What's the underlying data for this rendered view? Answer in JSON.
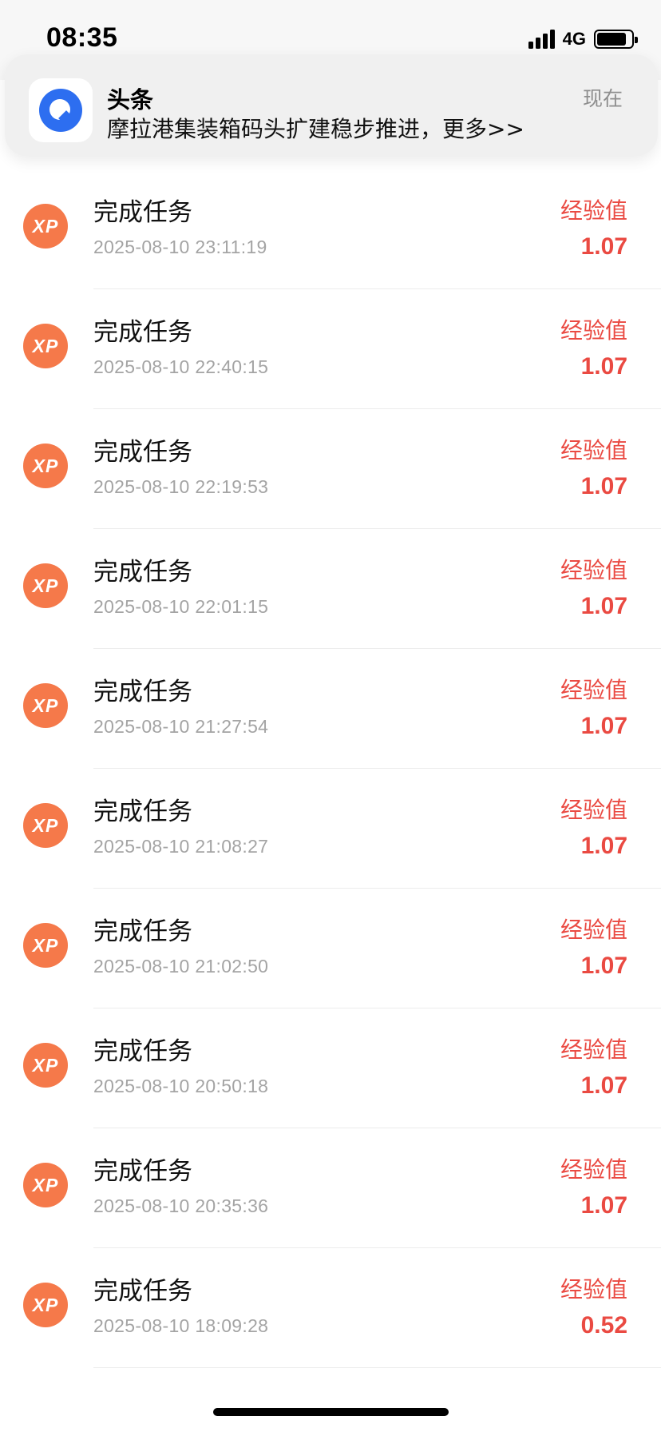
{
  "status_bar": {
    "time": "08:35",
    "network": "4G"
  },
  "notification": {
    "app": "头条",
    "time": "现在",
    "body": "摩拉港集装箱码头扩建稳步推进，更多>>",
    "icon": "toutiao-logo-icon",
    "icon_color": "#2d6ef0"
  },
  "records": {
    "icon": "xp-icon",
    "icon_text": "XP",
    "icon_color": "#f5794a",
    "accent_color": "#ea4a42",
    "items": [
      {
        "title": "完成任务",
        "time": "2025-08-10 23:11:19",
        "label": "经验值",
        "value": "1.07"
      },
      {
        "title": "完成任务",
        "time": "2025-08-10 22:40:15",
        "label": "经验值",
        "value": "1.07"
      },
      {
        "title": "完成任务",
        "time": "2025-08-10 22:19:53",
        "label": "经验值",
        "value": "1.07"
      },
      {
        "title": "完成任务",
        "time": "2025-08-10 22:01:15",
        "label": "经验值",
        "value": "1.07"
      },
      {
        "title": "完成任务",
        "time": "2025-08-10 21:27:54",
        "label": "经验值",
        "value": "1.07"
      },
      {
        "title": "完成任务",
        "time": "2025-08-10 21:08:27",
        "label": "经验值",
        "value": "1.07"
      },
      {
        "title": "完成任务",
        "time": "2025-08-10 21:02:50",
        "label": "经验值",
        "value": "1.07"
      },
      {
        "title": "完成任务",
        "time": "2025-08-10 20:50:18",
        "label": "经验值",
        "value": "1.07"
      },
      {
        "title": "完成任务",
        "time": "2025-08-10 20:35:36",
        "label": "经验值",
        "value": "1.07"
      },
      {
        "title": "完成任务",
        "time": "2025-08-10 18:09:28",
        "label": "经验值",
        "value": "0.52"
      }
    ]
  }
}
